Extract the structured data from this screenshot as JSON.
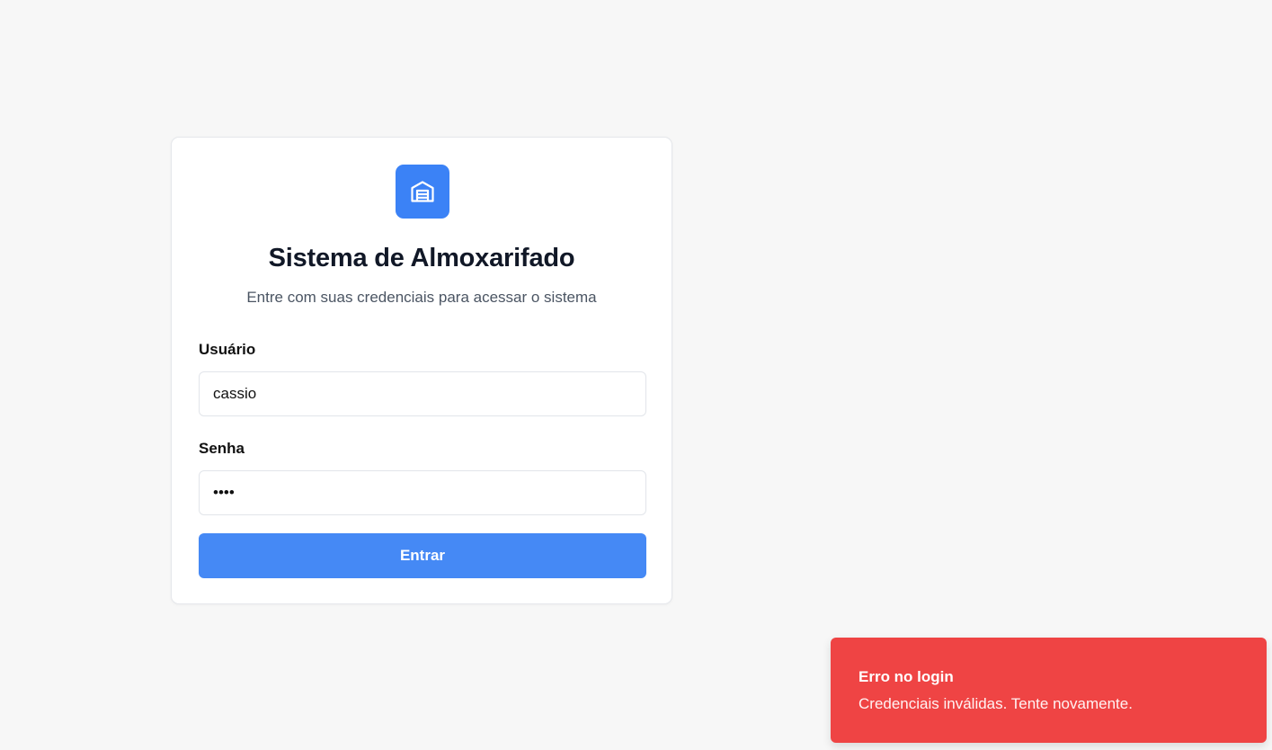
{
  "app": {
    "title": "Sistema de Almoxarifado",
    "subtitle": "Entre com suas credenciais para acessar o sistema",
    "logo_icon": "warehouse-icon",
    "accent_color": "#3b82f6"
  },
  "form": {
    "username": {
      "label": "Usuário",
      "value": "cassio"
    },
    "password": {
      "label": "Senha",
      "value": "••••"
    },
    "submit_label": "Entrar"
  },
  "toast": {
    "title": "Erro no login",
    "message": "Credenciais inválidas. Tente novamente.",
    "color": "#ef4444"
  }
}
